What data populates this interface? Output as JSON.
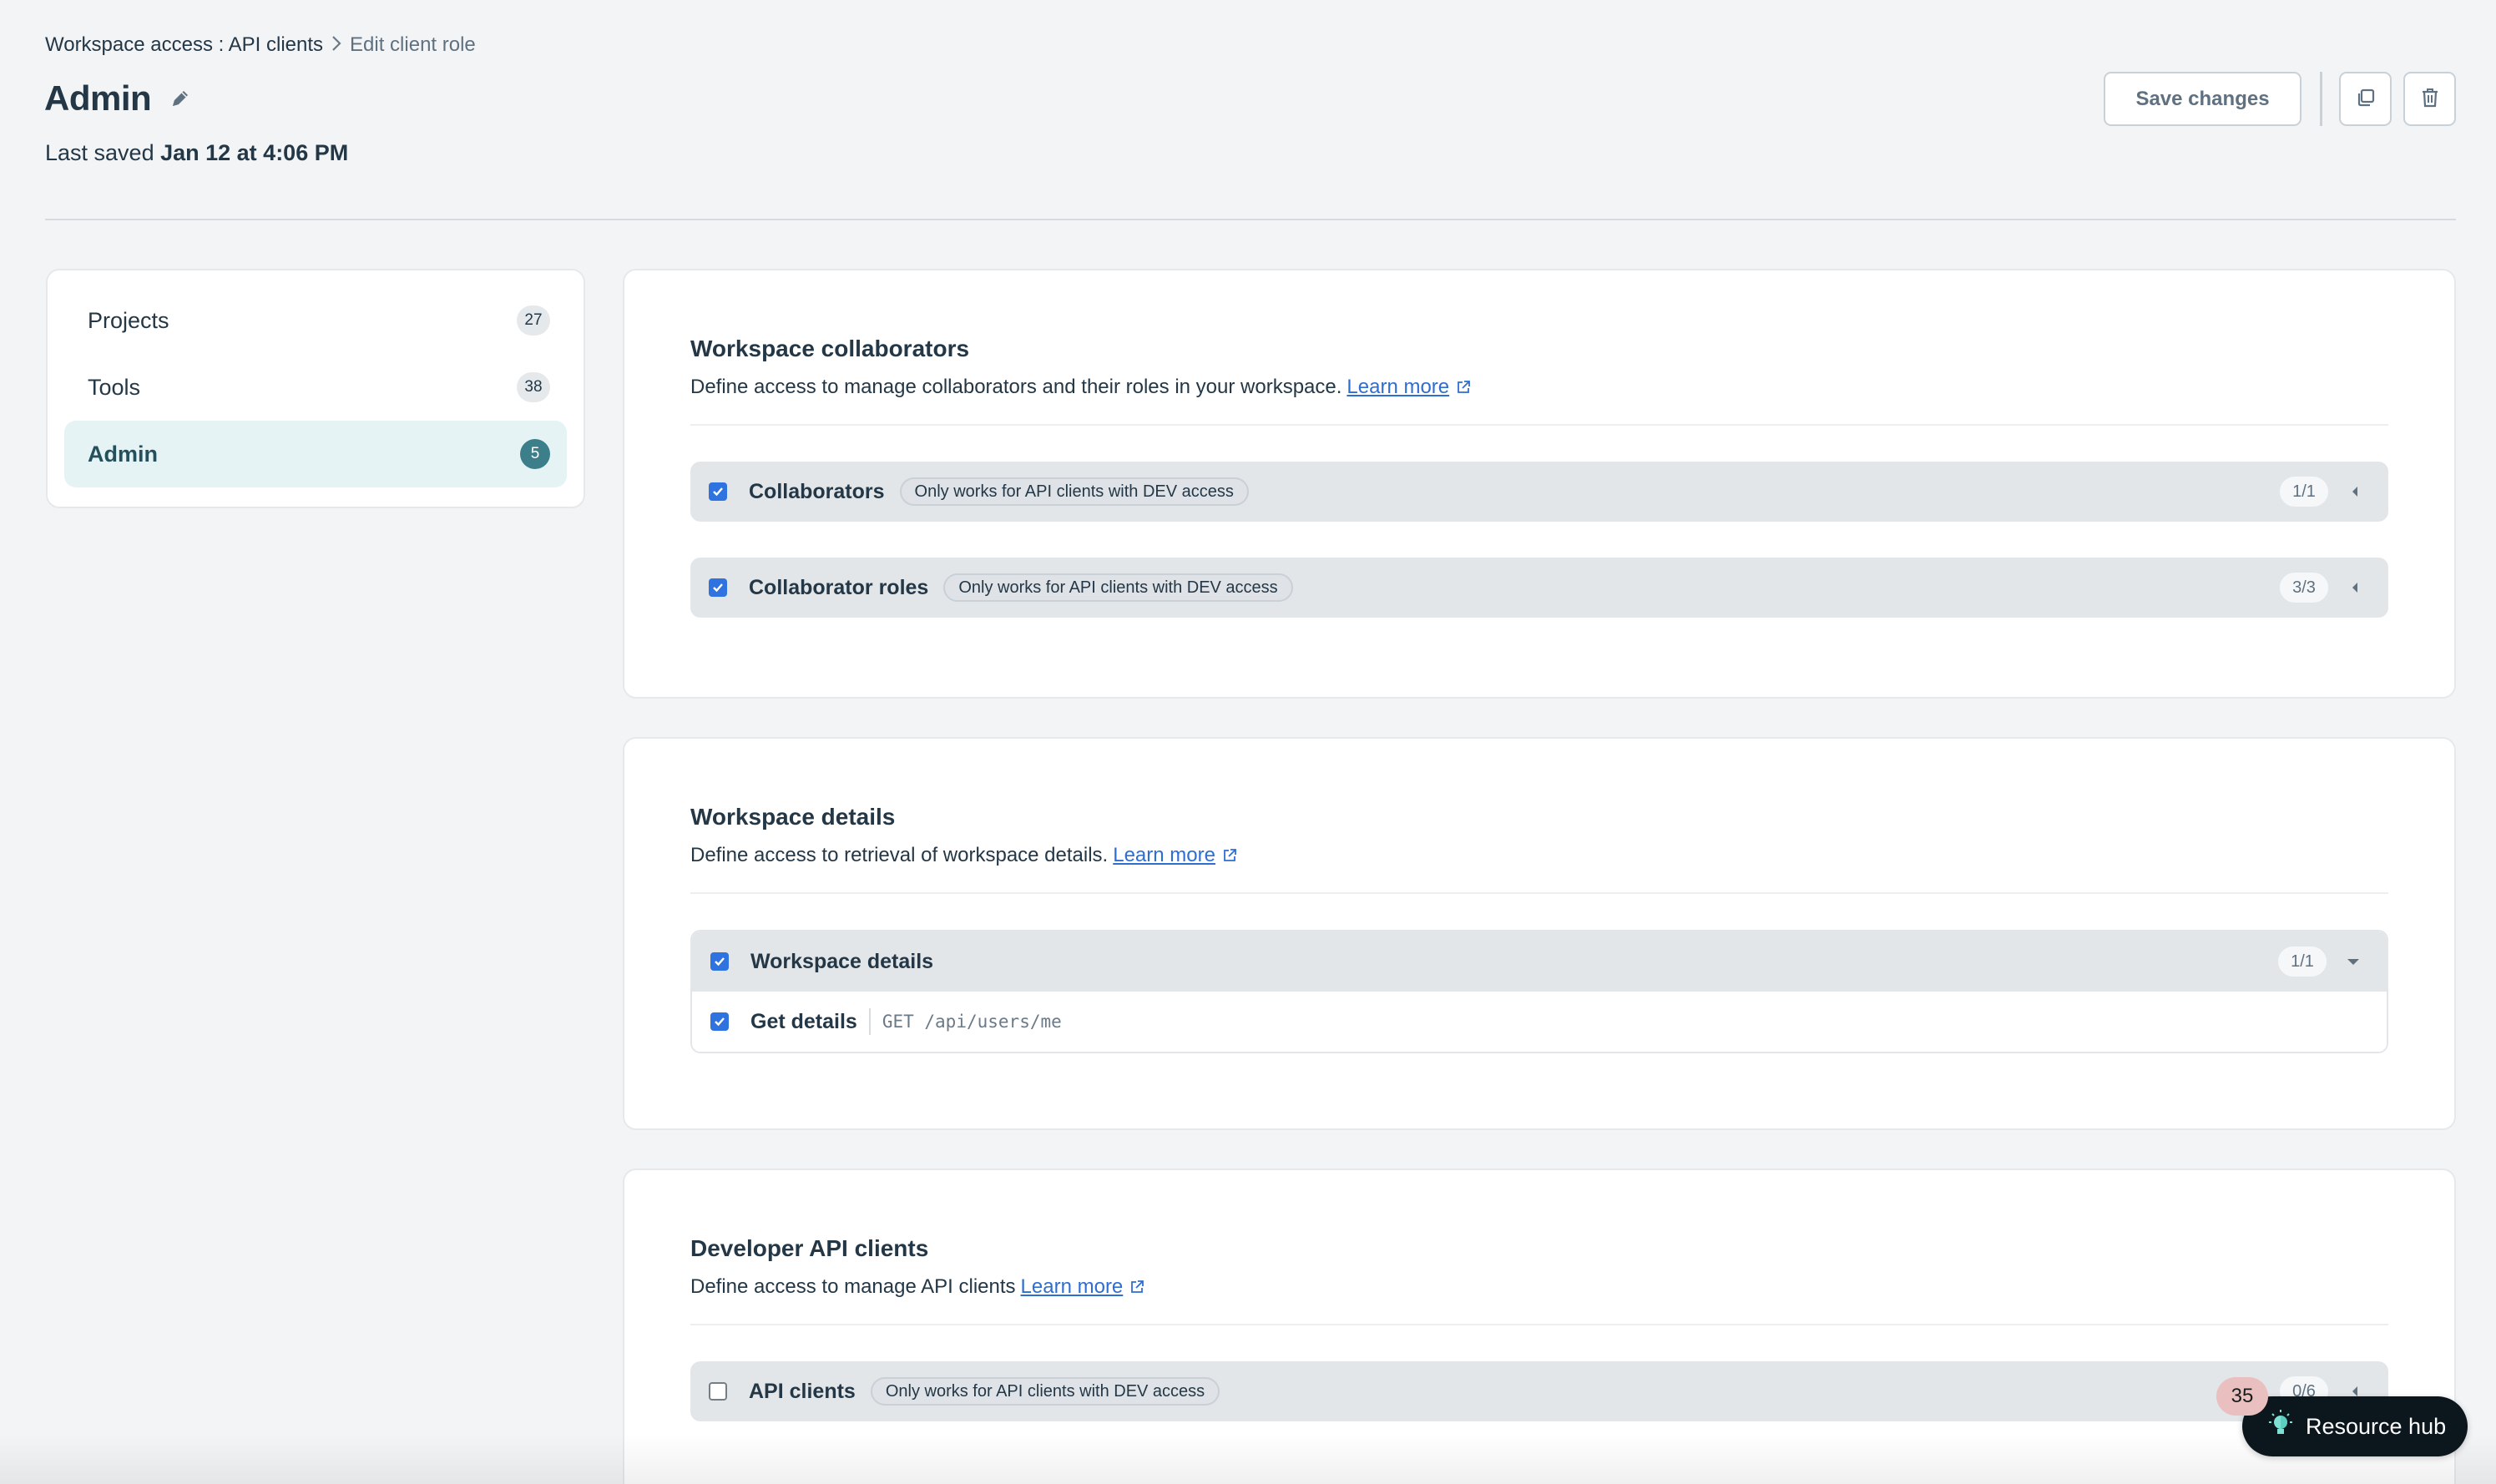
{
  "breadcrumb": {
    "parent": "Workspace access : API clients",
    "current": "Edit client role"
  },
  "header": {
    "title": "Admin",
    "last_saved_prefix": "Last saved",
    "last_saved_value": "Jan 12 at 4:06 PM",
    "save_label": "Save changes"
  },
  "sidebar": {
    "items": [
      {
        "label": "Projects",
        "count": "27",
        "active": false
      },
      {
        "label": "Tools",
        "count": "38",
        "active": false
      },
      {
        "label": "Admin",
        "count": "5",
        "active": true
      }
    ]
  },
  "sections": [
    {
      "title": "Workspace collaborators",
      "description": "Define access to manage collaborators and their roles in your workspace.",
      "learn_more": "Learn more",
      "groups": [
        {
          "name": "Collaborators",
          "checked": true,
          "note": "Only works for API clients with DEV access",
          "ratio": "1/1",
          "expanded": false
        },
        {
          "name": "Collaborator roles",
          "checked": true,
          "note": "Only works for API clients with DEV access",
          "ratio": "3/3",
          "expanded": false
        }
      ]
    },
    {
      "title": "Workspace details",
      "description": "Define access to retrieval of workspace details.",
      "learn_more": "Learn more",
      "groups": [
        {
          "name": "Workspace details",
          "checked": true,
          "ratio": "1/1",
          "expanded": true,
          "items": [
            {
              "name": "Get details",
              "checked": true,
              "endpoint": "GET /api/users/me"
            }
          ]
        }
      ]
    },
    {
      "title": "Developer API clients",
      "description": "Define access to manage API clients",
      "learn_more": "Learn more",
      "groups": [
        {
          "name": "API clients",
          "checked": false,
          "note": "Only works for API clients with DEV access",
          "ratio": "0/6",
          "expanded": false
        }
      ]
    }
  ],
  "floating": {
    "notification_count": "35",
    "resource_hub_label": "Resource hub"
  },
  "colors": {
    "accent": "#2f73e0",
    "link": "#2f6ed1",
    "active_badge": "#3c7f8a",
    "active_bg": "#e5f3f5",
    "text": "#233746"
  }
}
